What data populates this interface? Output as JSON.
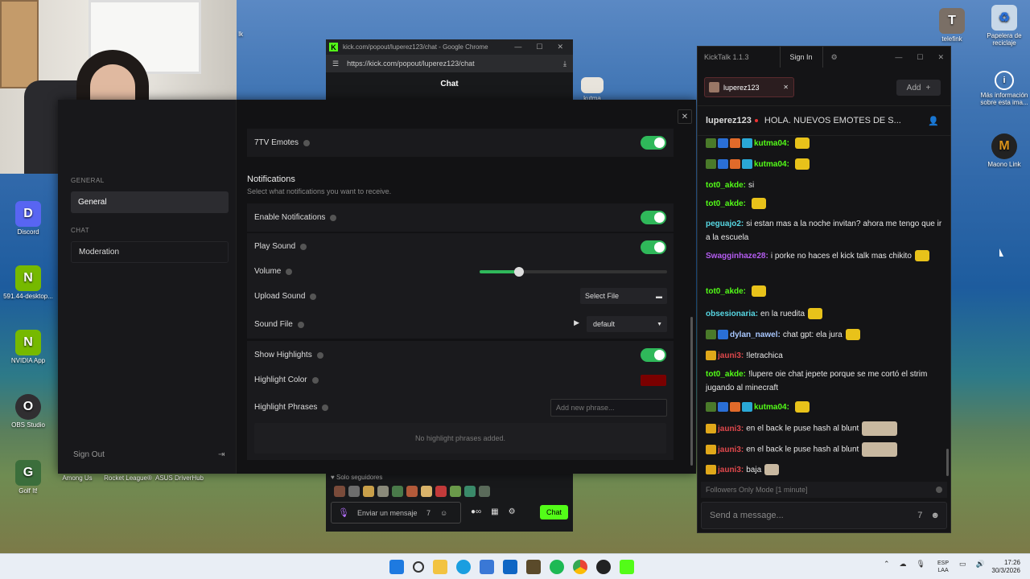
{
  "desktop": {
    "icons": [
      {
        "label": "Discord",
        "color": "#5865f2",
        "glyph": "D"
      },
      {
        "label": "591.44-desktop...",
        "color": "#76b900",
        "glyph": "N"
      },
      {
        "label": "NVIDIA App",
        "color": "#76b900",
        "glyph": "N"
      },
      {
        "label": "OBS Studio",
        "color": "#302e31",
        "glyph": "O"
      },
      {
        "label": "Golf It!",
        "color": "#3b6e3b",
        "glyph": "G"
      },
      {
        "label": "Among Us",
        "color": "#c51111",
        "glyph": "A"
      },
      {
        "label": "Rocket League®",
        "color": "#1f4e9e",
        "glyph": "R"
      },
      {
        "label": "ASUS DriverHub",
        "color": "#2b5aa8",
        "glyph": "A"
      },
      {
        "label": "telefink",
        "color": "#7a6f66",
        "glyph": "T"
      },
      {
        "label": "Papelera de reciclaje",
        "color": "#c8d8e8",
        "glyph": "♻"
      },
      {
        "label": "Más información sobre esta ima...",
        "color": "#3a5f8a",
        "glyph": "i"
      },
      {
        "label": "Maono Link",
        "color": "#d9931c",
        "glyph": "M"
      }
    ],
    "partial_labels": [
      "lk",
      "kutma"
    ]
  },
  "chrome_popup": {
    "title": "kick.com/popout/luperez123/chat - Google Chrome",
    "url": "https://kick.com/popout/luperez123/chat",
    "chat_header": "Chat",
    "followers_only": "Solo seguidores",
    "input_placeholder": "Enviar un mensaje",
    "chat_button": "Chat"
  },
  "settings": {
    "sidebar": {
      "general_section": "GENERAL",
      "general_item": "General",
      "chat_section": "CHAT",
      "moderation_item": "Moderation",
      "sign_out": "Sign Out"
    },
    "emotes_row": "7TV Emotes",
    "notifications_title": "Notifications",
    "notifications_sub": "Select what notifications you want to receive.",
    "enable_notifications": "Enable Notifications",
    "play_sound": "Play Sound",
    "volume": "Volume",
    "volume_value": 0.21,
    "upload_sound": "Upload Sound",
    "select_file": "Select File",
    "sound_file": "Sound File",
    "sound_file_value": "default",
    "show_highlights": "Show Highlights",
    "highlight_color": "Highlight Color",
    "highlight_color_value": "#7a0000",
    "highlight_phrases": "Highlight Phrases",
    "phrase_placeholder": "Add new phrase...",
    "no_phrases": "No highlight phrases added.",
    "toggle_color": "#2fb85a"
  },
  "kicktalk": {
    "app_title": "KickTalk 1.1.3",
    "sign_in": "Sign In",
    "tab_name": "luperez123",
    "add_button": "Add",
    "channel": "luperez123",
    "stream_title": "HOLA. NUEVOS EMOTES DE S...",
    "messages": [
      {
        "user": "kutma04:",
        "color": "#53fc18",
        "text": "",
        "badges": 4,
        "emote": true
      },
      {
        "user": "kutma04:",
        "color": "#53fc18",
        "text": "",
        "badges": 4,
        "emote": true
      },
      {
        "user": "tot0_akde:",
        "color": "#53fc18",
        "text": "si",
        "badges": 0,
        "emote": false
      },
      {
        "user": "tot0_akde:",
        "color": "#53fc18",
        "text": "",
        "badges": 0,
        "emote": true
      },
      {
        "user": "peguajo2:",
        "color": "#57d7e3",
        "text": "si estan mas a la noche invitan? ahora me tengo que ir a la escuela",
        "badges": 0,
        "emote": false
      },
      {
        "user": "Swagginhaze28:",
        "color": "#b45cf0",
        "text": "i porke no haces el kick talk mas chikito",
        "badges": 0,
        "emote": true
      },
      {
        "user": "tot0_akde:",
        "color": "#53fc18",
        "text": "",
        "badges": 0,
        "emote": true
      },
      {
        "user": "obsesionaria:",
        "color": "#57d7e3",
        "text": "en la ruedita",
        "badges": 0,
        "emote": true
      },
      {
        "user": "dylan_nawel:",
        "color": "#a9c8ff",
        "text": "chat gpt: ela jura",
        "badges": 2,
        "emote": true
      },
      {
        "user": "jauni3:",
        "color": "#e0484c",
        "text": "!letrachica",
        "badges": 1,
        "emote": false
      },
      {
        "user": "tot0_akde:",
        "color": "#53fc18",
        "text": "!lupere oie chat jepete porque se me cortó el strim jugando al minecraft",
        "badges": 0,
        "emote": false
      },
      {
        "user": "kutma04:",
        "color": "#53fc18",
        "text": "",
        "badges": 4,
        "emote": true
      },
      {
        "user": "jauni3:",
        "color": "#e0484c",
        "text": "en el back le puse hash al blunt",
        "badges": 1,
        "emote": true
      },
      {
        "user": "jauni3:",
        "color": "#e0484c",
        "text": "en el back le puse hash al blunt",
        "badges": 1,
        "emote": true
      },
      {
        "user": "jauni3:",
        "color": "#e0484c",
        "text": "baja",
        "badges": 1,
        "emote": true
      }
    ],
    "followers_only": "Followers Only Mode [1 minute]",
    "send_placeholder": "Send a message..."
  },
  "taskbar": {
    "lang_line1": "ESP",
    "lang_line2": "LAA",
    "time": "17:26",
    "date": "30/3/2026"
  }
}
